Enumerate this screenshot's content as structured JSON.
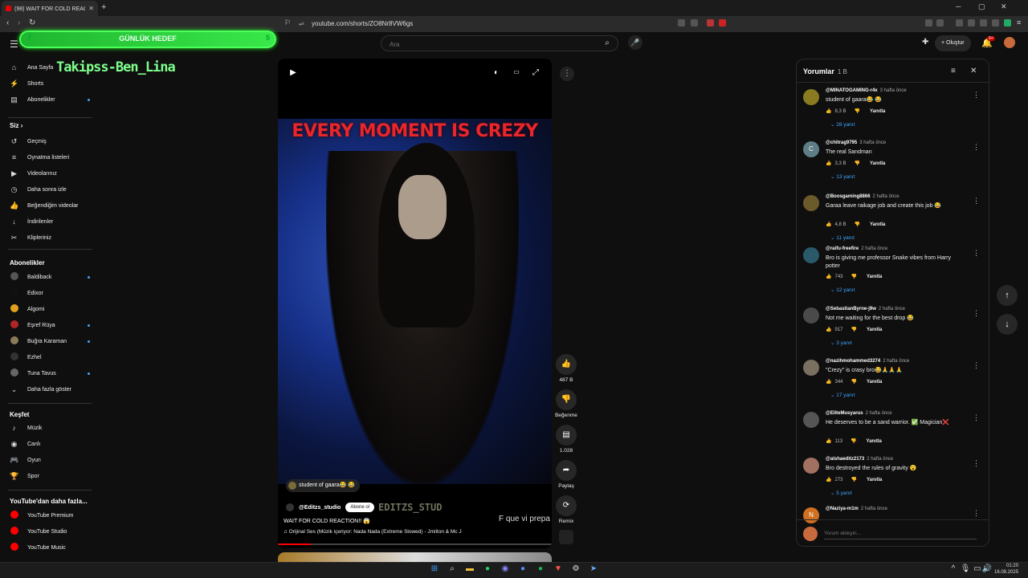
{
  "browser": {
    "tab_title": "(98) WAIT FOR COLD REACTION!! 😱",
    "tab_close": "✕",
    "new_tab": "+",
    "url": "youtube.com/shorts/ZO8Nr8VW6gs",
    "window_controls": [
      "─",
      "▢",
      "✕"
    ]
  },
  "header": {
    "search_placeholder": "Ara",
    "create_label": "Oluştur",
    "notification_badge": "9+"
  },
  "overlay": {
    "goal_left": "7",
    "goal_label": "GÜNLÜK HEDEF",
    "goal_right": "5",
    "streamer_name": "Takipss-Ben_Lina"
  },
  "sidebar": {
    "main": [
      {
        "label": "Ana Sayfa",
        "icon": "⌂"
      },
      {
        "label": "Shorts",
        "icon": "⚡"
      },
      {
        "label": "Abonelikler",
        "icon": "▤"
      }
    ],
    "you_header": "Siz",
    "you": [
      {
        "label": "Geçmiş",
        "icon": "↺"
      },
      {
        "label": "Oynatma listeleri",
        "icon": "≡"
      },
      {
        "label": "Videolarınız",
        "icon": "▶"
      },
      {
        "label": "Daha sonra izle",
        "icon": "◷"
      },
      {
        "label": "Beğendiğim videolar",
        "icon": "👍"
      },
      {
        "label": "İndirilenler",
        "icon": "↓"
      },
      {
        "label": "Klipleriniz",
        "icon": "✂"
      }
    ],
    "subs_header": "Abonelikler",
    "subs": [
      {
        "label": "Baldiback",
        "color": "#555555",
        "dot": true
      },
      {
        "label": "Edixor",
        "color": "#111111",
        "dot": false
      },
      {
        "label": "Algomi",
        "color": "#e0a21e",
        "dot": false
      },
      {
        "label": "Eşref Rüya",
        "color": "#b02525",
        "dot": true
      },
      {
        "label": "Buğra Karaman",
        "color": "#8a7a5a",
        "dot": true
      },
      {
        "label": "Ezhel",
        "color": "#333333",
        "dot": false
      },
      {
        "label": "Tuna Tavus",
        "color": "#666666",
        "dot": true
      }
    ],
    "show_more": "Daha fazla göster",
    "explore_header": "Keşfet",
    "explore": [
      {
        "label": "Müzik",
        "icon": "♪"
      },
      {
        "label": "Canlı",
        "icon": "◉"
      },
      {
        "label": "Oyun",
        "icon": "🎮"
      },
      {
        "label": "Spor",
        "icon": "🏆"
      }
    ],
    "more_header": "YouTube'dan daha fazla...",
    "more": [
      {
        "label": "YouTube Premium"
      },
      {
        "label": "YouTube Studio"
      },
      {
        "label": "YouTube Music"
      }
    ],
    "accent": "#ff0000"
  },
  "video": {
    "overlay_title": "EVERY MOMENT IS CREZY",
    "watermark": "EDITZS_STUD",
    "comment_pill": "student of gaara😂 😂",
    "channel": "@Editzs_studio",
    "subscribe": "Abone ol",
    "title": "WAIT FOR COLD  REACTION!! 😱",
    "music": "♫ Orijinal Ses (Müzik içeriyor: Nada Nada (Extreme Slowed) - Jmilton & Mc J",
    "subtitle": "F que vi prepa",
    "progress": 0.12
  },
  "actions": {
    "likes": "487 B",
    "dislike": "Beğenme",
    "comments": "1.028",
    "share": "Paylaş",
    "remix": "Remix"
  },
  "comments_panel": {
    "title": "Yorumlar",
    "count": "1 B",
    "reply_label": "Yanıtla",
    "add_placeholder": "Yorum ekleyin...",
    "items": [
      {
        "user": "@MINATOGAMING-r4x",
        "time": "3 hafta önce",
        "text": "student of gaara😂 😂",
        "likes": "8,3 B",
        "replies": "28 yanıt",
        "avatar": "#8a7a20"
      },
      {
        "user": "@chitrag9795",
        "time": "3 hafta önce",
        "text": "The real Sandman",
        "likes": "3,3 B",
        "replies": "13 yanıt",
        "avatar": "#5f7d87",
        "initial": "C"
      },
      {
        "user": "@Boosgaming8866",
        "time": "2 hafta önce",
        "text": "Garaa leave raikage job and create this job 😂",
        "likes": "4,8 B",
        "replies": "11 yanıt",
        "avatar": "#6b5a2a"
      },
      {
        "user": "@raifu-freefire",
        "time": "2 hafta önce",
        "text": "Bro is giving me professor Snake vibes from Harry potter",
        "likes": "743",
        "replies": "12 yanıt",
        "avatar": "#2a5a6a"
      },
      {
        "user": "@SebastianByrne-j9w",
        "time": "2 hafta önce",
        "text": "Not me waiting for the best drop 😂",
        "likes": "917",
        "replies": "3 yanıt",
        "avatar": "#4a4a4a"
      },
      {
        "user": "@nazihmohammed3274",
        "time": "2 hafta önce",
        "text": "\"Crezy\" is crasy bro😂🙏🙏🙏",
        "likes": "344",
        "replies": "17 yanıt",
        "avatar": "#7a7060"
      },
      {
        "user": "@EliteMusyarus",
        "time": "2 hafta önce",
        "text": "He deserves to be a sand warrior. ✅ Magician❌",
        "likes": "113",
        "replies": "",
        "avatar": "#555555"
      },
      {
        "user": "@alshaeditz2173",
        "time": "2 hafta önce",
        "text": "Bro destroyed the rules of gravity 😮",
        "likes": "273",
        "replies": "5 yanıt",
        "avatar": "#a07060"
      },
      {
        "user": "@Naziya-m1m",
        "time": "2 hafta önce",
        "text": "",
        "likes": "",
        "replies": "",
        "avatar": "#d07020",
        "initial": "N"
      }
    ]
  },
  "taskbar": {
    "time": "01:20",
    "date": "16.08.2025"
  }
}
